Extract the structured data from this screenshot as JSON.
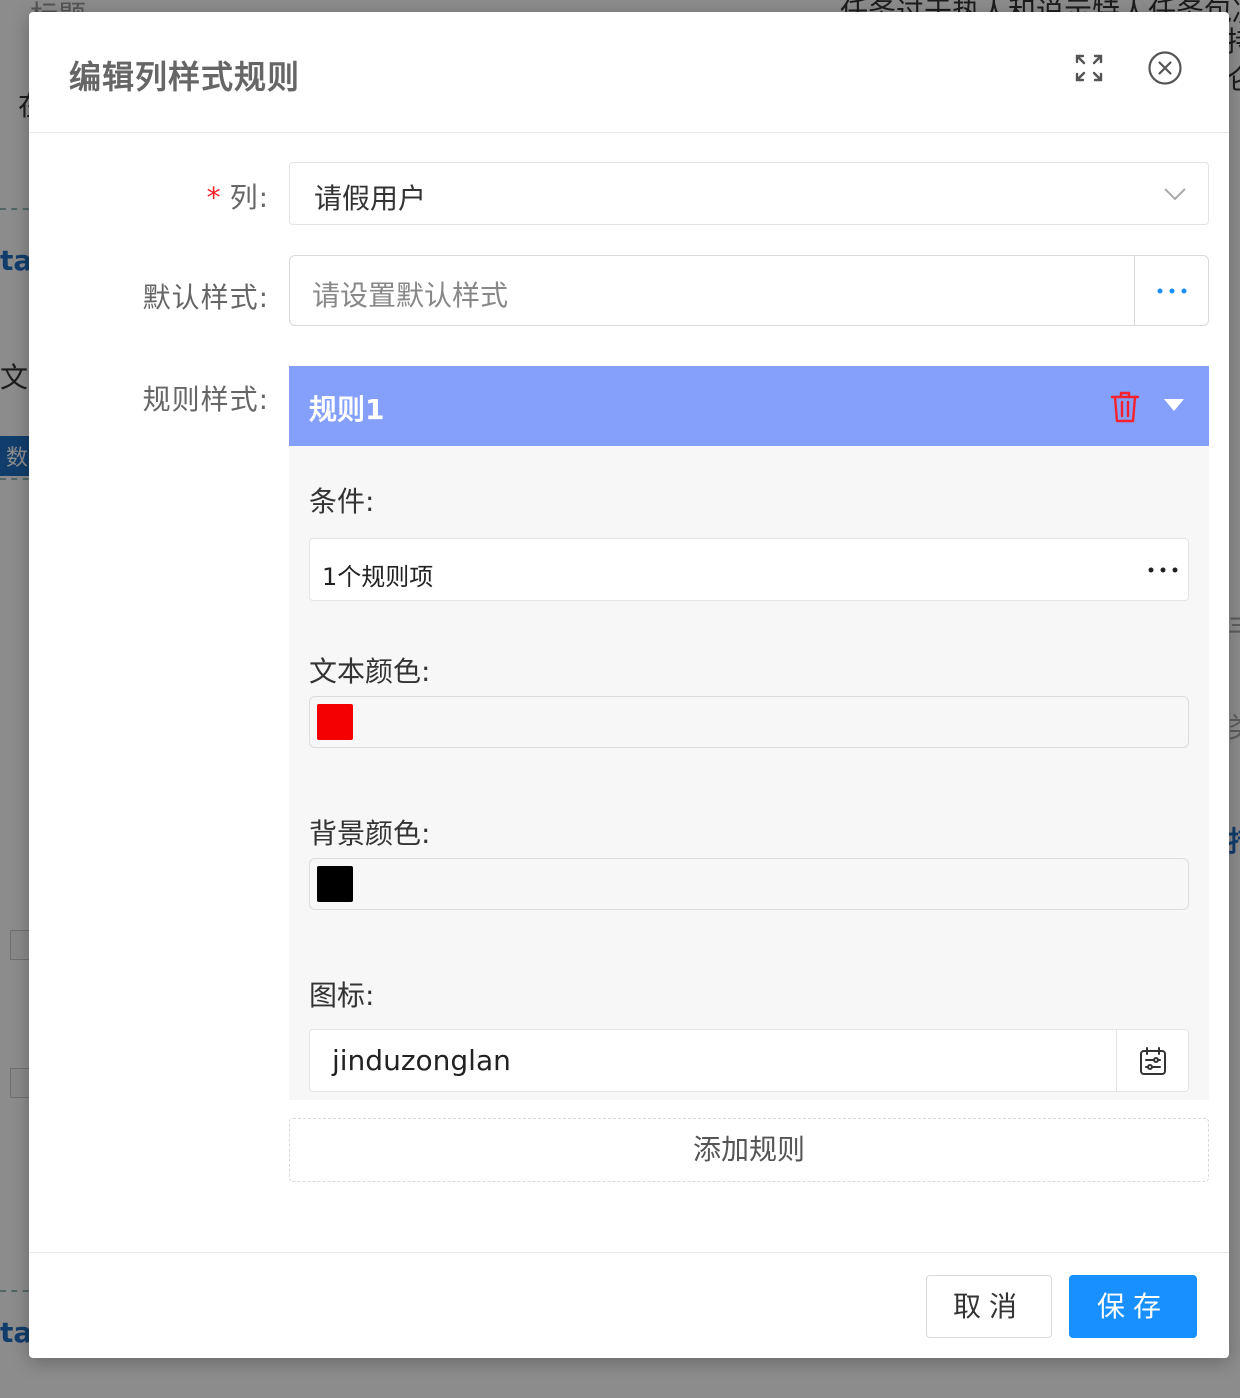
{
  "background": {
    "fragments": [
      "标题",
      "在",
      "ta",
      "文本",
      "数",
      "任务过于热人和说示特人任务包决策",
      "持",
      "仑",
      "丰",
      "类",
      "措",
      "ta"
    ]
  },
  "modal": {
    "title": "编辑列样式规则",
    "fullscreen_icon": "fullscreen-icon",
    "close_icon": "close-circle-icon"
  },
  "form": {
    "column": {
      "required_mark": "*",
      "label": "列:",
      "value": "请假用户"
    },
    "default_style": {
      "label": "默认样式:",
      "placeholder": "请设置默认样式"
    },
    "rule_style": {
      "label": "规则样式:"
    }
  },
  "rule": {
    "title": "规则1",
    "condition_label": "条件:",
    "condition_value": "1个规则项",
    "text_color_label": "文本颜色:",
    "text_color": "#f50000",
    "bg_color_label": "背景颜色:",
    "bg_color": "#000000",
    "icon_label": "图标:",
    "icon_value": "jinduzonglan"
  },
  "add_rule_label": "添加规则",
  "footer": {
    "cancel_label": "取消",
    "save_label": "保存"
  },
  "colors": {
    "accent": "#1890ff",
    "rule_header": "#85a0fa",
    "danger": "#f5222d"
  }
}
